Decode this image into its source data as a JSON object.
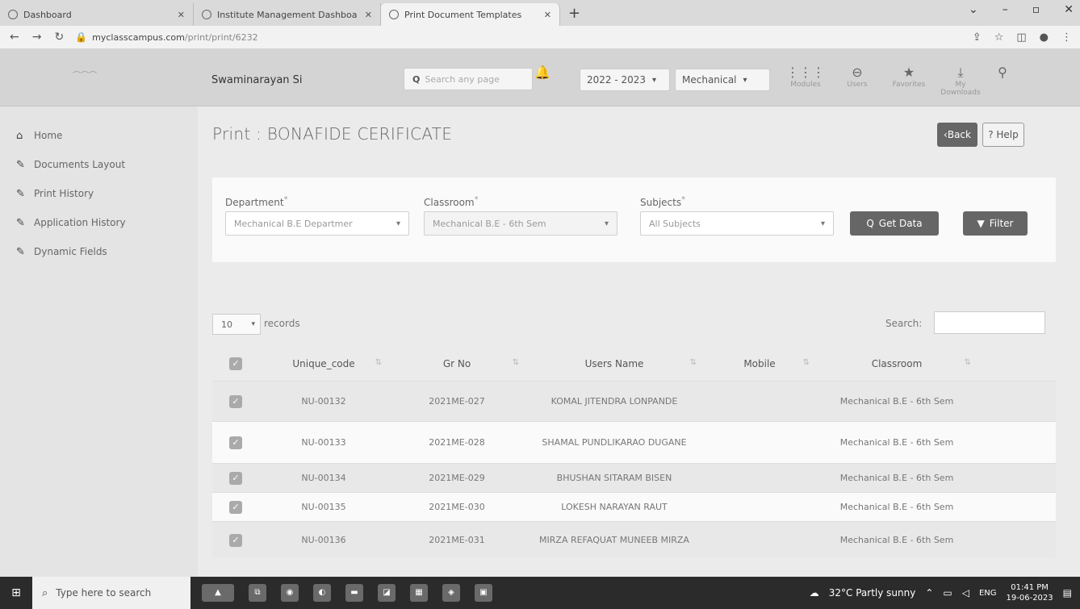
{
  "browser": {
    "tabs": [
      {
        "label": "Dashboard"
      },
      {
        "label": "Institute Management Dashboa"
      },
      {
        "label": "Print Document Templates"
      }
    ],
    "new_tab": "+",
    "url": "myclasscampus.com",
    "url_path": "/print/print/6232"
  },
  "header": {
    "institute": "Swaminarayan Si",
    "search_placeholder": "Search any page",
    "year": "2022 - 2023",
    "branch": "Mechanical",
    "icons": [
      {
        "label": "Modules",
        "icon": "grid-icon"
      },
      {
        "label": "Users",
        "icon": "users-icon"
      },
      {
        "label": "Favorites",
        "icon": "star-icon"
      },
      {
        "label": "My Downloads",
        "icon": "download-icon"
      }
    ]
  },
  "sidebar": {
    "items": [
      {
        "label": "Home",
        "icon": "home-icon"
      },
      {
        "label": "Documents Layout",
        "icon": "pen-icon"
      },
      {
        "label": "Print History",
        "icon": "pen-icon"
      },
      {
        "label": "Application History",
        "icon": "pen-icon"
      },
      {
        "label": "Dynamic Fields",
        "icon": "pen-icon"
      }
    ]
  },
  "page": {
    "title": "Print : BONAFIDE CERIFICATE",
    "back_label": "‹Back",
    "help_label": "? Help"
  },
  "filters": {
    "department_label": "Department",
    "department_value": "Mechanical B.E Departmer",
    "classroom_label": "Classroom",
    "classroom_value": "Mechanical B.E - 6th Sem",
    "subjects_label": "Subjects",
    "subjects_value": "All Subjects",
    "get_data_label": "Get Data",
    "filter_label": "Filter"
  },
  "table": {
    "page_size": "10",
    "records_label": "records",
    "search_label": "Search:",
    "columns": [
      "Unique_code",
      "Gr No",
      "Users Name",
      "Mobile",
      "Classroom"
    ],
    "rows": [
      {
        "code": "NU-00132",
        "gr": "2021ME-027",
        "name": "KOMAL JITENDRA LONPANDE",
        "mobile": "",
        "classroom": "Mechanical B.E - 6th Sem"
      },
      {
        "code": "NU-00133",
        "gr": "2021ME-028",
        "name": "SHAMAL PUNDLIKARAO DUGANE",
        "mobile": "",
        "classroom": "Mechanical B.E - 6th Sem"
      },
      {
        "code": "NU-00134",
        "gr": "2021ME-029",
        "name": "BHUSHAN SITARAM BISEN",
        "mobile": "",
        "classroom": "Mechanical B.E - 6th Sem"
      },
      {
        "code": "NU-00135",
        "gr": "2021ME-030",
        "name": "LOKESH NARAYAN RAUT",
        "mobile": "",
        "classroom": "Mechanical B.E - 6th Sem"
      },
      {
        "code": "NU-00136",
        "gr": "2021ME-031",
        "name": "MIRZA REFAQUAT MUNEEB MIRZA",
        "mobile": "",
        "classroom": "Mechanical B.E - 6th Sem"
      }
    ]
  },
  "taskbar": {
    "search_placeholder": "Type here to search",
    "weather": "32°C Partly sunny",
    "lang": "ENG",
    "time": "01:41 PM",
    "date": "19-06-2023"
  }
}
